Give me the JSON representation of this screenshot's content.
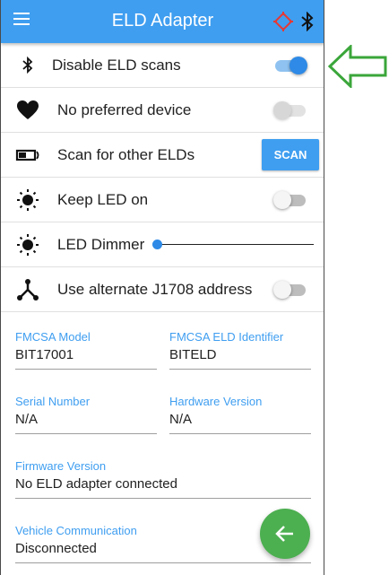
{
  "appbar": {
    "title": "ELD Adapter",
    "menu_icon": "hamburger-menu-icon",
    "status_icons": [
      "target-icon",
      "bluetooth-icon"
    ]
  },
  "settings": [
    {
      "icon": "bluetooth-icon",
      "label": "Disable ELD scans",
      "control": "switch",
      "state": "on"
    },
    {
      "icon": "heart-icon",
      "label": "No preferred device",
      "control": "switch",
      "state": "off-disabled"
    },
    {
      "icon": "scan-device-icon",
      "label": "Scan for other ELDs",
      "control": "button",
      "button_label": "SCAN"
    },
    {
      "icon": "brightness-icon",
      "label": "Keep LED on",
      "control": "switch",
      "state": "off"
    },
    {
      "icon": "brightness-icon",
      "label": "LED Dimmer",
      "control": "slider",
      "value": 0
    },
    {
      "icon": "network-fork-icon",
      "label": "Use alternate J1708 address",
      "control": "switch",
      "state": "off"
    }
  ],
  "fields": {
    "fmcsa_model": {
      "label": "FMCSA Model",
      "value": "BIT17001"
    },
    "fmcsa_eld_identifier": {
      "label": "FMCSA ELD Identifier",
      "value": "BITELD"
    },
    "serial_number": {
      "label": "Serial Number",
      "value": "N/A"
    },
    "hardware_version": {
      "label": "Hardware Version",
      "value": "N/A"
    },
    "firmware_version": {
      "label": "Firmware Version",
      "value": "No ELD adapter connected"
    },
    "vehicle_communication": {
      "label": "Vehicle Communication",
      "value": "Disconnected"
    }
  },
  "fab": {
    "icon": "arrow-left-icon"
  },
  "annotation": {
    "icon": "green-arrow-left-outline-icon"
  },
  "colors": {
    "primary": "#3f9ef0",
    "switch_on": "#2e8ae6",
    "fab": "#4caf50",
    "annotation_arrow": "#3aa63a",
    "target_icon": "#e53935"
  }
}
